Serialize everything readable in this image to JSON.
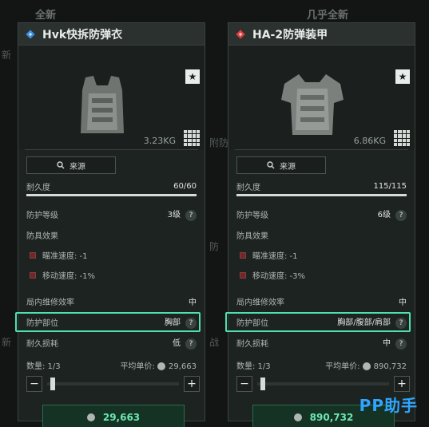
{
  "background": {
    "left_header": "全新",
    "right_header": "几乎全新",
    "side_fragments": [
      "新",
      "附防",
      "防",
      "新",
      "战"
    ]
  },
  "panels": [
    {
      "title": "Hvk快拆防弹衣",
      "title_icon_color": "#3a8fe0",
      "weight": "3.23KG",
      "source_label": "来源",
      "durability_label": "耐久度",
      "durability_value": "60/60",
      "durability": 1.0,
      "protection_label": "防护等级",
      "protection_value": "3级",
      "armor_effects_label": "防具效果",
      "effects": [
        {
          "label": "瞄准速度: -1"
        },
        {
          "label": "移动速度: -1%"
        }
      ],
      "repair_label": "局内维修效率",
      "repair_value": "中",
      "area_label": "防护部位",
      "area_value": "胸部",
      "loss_label": "耐久损耗",
      "loss_value": "低",
      "qty_label": "数量: 1/3",
      "unit_price_label": "平均单价:",
      "unit_price": "29,663",
      "slider_fraction": 0.0,
      "buy_price": "29,663"
    },
    {
      "title": "HA-2防弹装甲",
      "title_icon_color": "#e04040",
      "weight": "6.86KG",
      "source_label": "来源",
      "durability_label": "耐久度",
      "durability_value": "115/115",
      "durability": 1.0,
      "protection_label": "防护等级",
      "protection_value": "6级",
      "armor_effects_label": "防具效果",
      "effects": [
        {
          "label": "瞄准速度: -1"
        },
        {
          "label": "移动速度: -3%"
        }
      ],
      "repair_label": "局内维修效率",
      "repair_value": "中",
      "area_label": "防护部位",
      "area_value": "胸部/腹部/肩部",
      "loss_label": "耐久损耗",
      "loss_value": "中",
      "qty_label": "数量: 1/3",
      "unit_price_label": "平均单价:",
      "unit_price": "890,732",
      "slider_fraction": 0.0,
      "buy_price": "890,732"
    }
  ],
  "watermark": "PP助手",
  "colors": {
    "highlight": "#4ee0b0",
    "buy_text": "#6ee6b0",
    "watermark": "#2ea6ff"
  }
}
